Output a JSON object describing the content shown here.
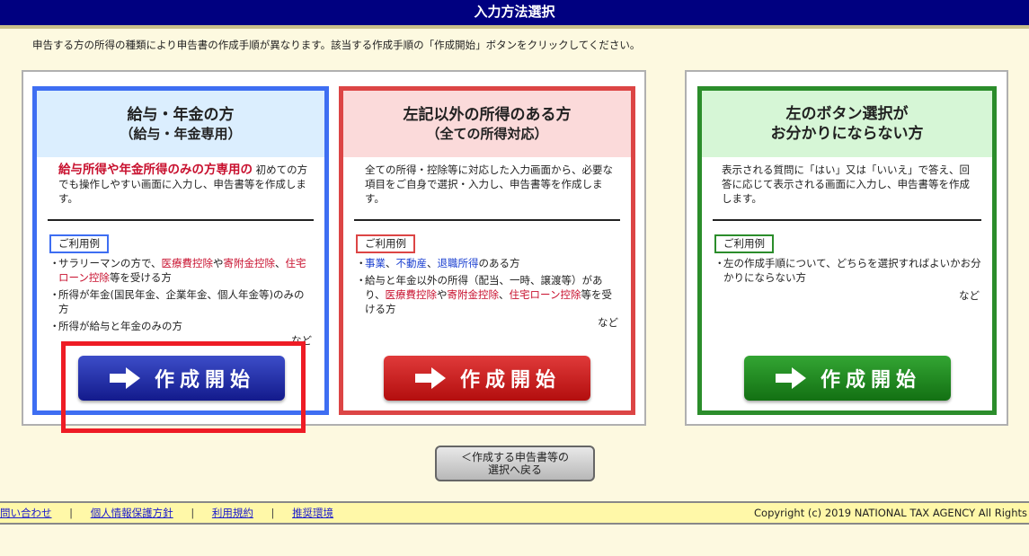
{
  "header": {
    "title": "入力方法選択"
  },
  "instruction": "申告する方の所得の種類により申告書の作成手順が異なります。該当する作成手順の「作成開始」ボタンをクリックしてください。",
  "colors": {
    "blue": "#3e6ef2",
    "red": "#dc4545",
    "green": "#2b8d2b",
    "highlight": "#ee1c25"
  },
  "cards": [
    {
      "title": "給与・年金の方",
      "subtitle": "（給与・年金専用）",
      "desc_em": "給与所得や年金所得のみの方専用の",
      "desc": "初めての方でも操作しやすい画面に入力し、申告書等を作成します。",
      "tag": "ご利用例",
      "ex1_a": "サラリーマンの方で、",
      "ex1_b": "医療費控除",
      "ex1_c": "や",
      "ex1_d": "寄附金控除",
      "ex1_e": "、",
      "ex1_f": "住宅ローン控除",
      "ex1_g": "等を受ける方",
      "ex2": "所得が年金(国民年金、企業年金、個人年金等)のみの方",
      "ex3": "所得が給与と年金のみの方",
      "nado": "など",
      "button": "作成開始"
    },
    {
      "title": "左記以外の所得のある方",
      "subtitle": "（全ての所得対応）",
      "desc": "全ての所得・控除等に対応した入力画面から、必要な項目をご自身で選択・入力し、申告書等を作成します。",
      "tag": "ご利用例",
      "ex1_a": "事業",
      "ex1_b": "、",
      "ex1_c": "不動産",
      "ex1_d": "、",
      "ex1_e": "退職所得",
      "ex1_f": "のある方",
      "ex2_a": "給与と年金以外の所得（配当、一時、譲渡等）があり、",
      "ex2_b": "医療費控除",
      "ex2_c": "や",
      "ex2_d": "寄附金控除",
      "ex2_e": "、",
      "ex2_f": "住宅ローン控除",
      "ex2_g": "等を受ける方",
      "nado": "など",
      "button": "作成開始"
    },
    {
      "title": "左のボタン選択が",
      "subtitle": "お分かりにならない方",
      "desc": "表示される質問に「はい」又は「いいえ」で答え、回答に応じて表示される画面に入力し、申告書等を作成します。",
      "tag": "ご利用例",
      "ex1": "左の作成手順について、どちらを選択すればよいかお分かりにならない方",
      "nado": "など",
      "button": "作成開始"
    }
  ],
  "back_button": {
    "line1": "＜作成する申告書等の",
    "line2": "選択へ戻る"
  },
  "footer": {
    "links": [
      "問い合わせ",
      "個人情報保護方針",
      "利用規約",
      "推奨環境"
    ],
    "separator": "|",
    "copyright": "Copyright (c) 2019 NATIONAL TAX AGENCY All Rights"
  }
}
